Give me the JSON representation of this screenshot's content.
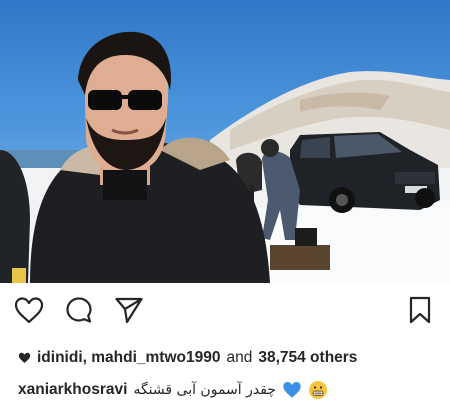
{
  "post": {
    "likes": {
      "users": "idinidi, mahdi_mtwo1990",
      "conjunction": "and",
      "count_text": "38,754 others"
    },
    "caption": {
      "username": "xaniarkhosravi",
      "text": "چقدر آسمون آبی قشنگه",
      "emojis": [
        "blue-heart",
        "grimacing-face"
      ]
    }
  },
  "icons": {
    "like": "heart-outline-icon",
    "comment": "speech-bubble-icon",
    "share": "paper-plane-icon",
    "save": "bookmark-icon",
    "likes_prefix": "heart-filled-icon"
  },
  "colors": {
    "text": "#262626",
    "blue_heart": "#3a8fe8",
    "emoji_yellow": "#f6c53d"
  }
}
